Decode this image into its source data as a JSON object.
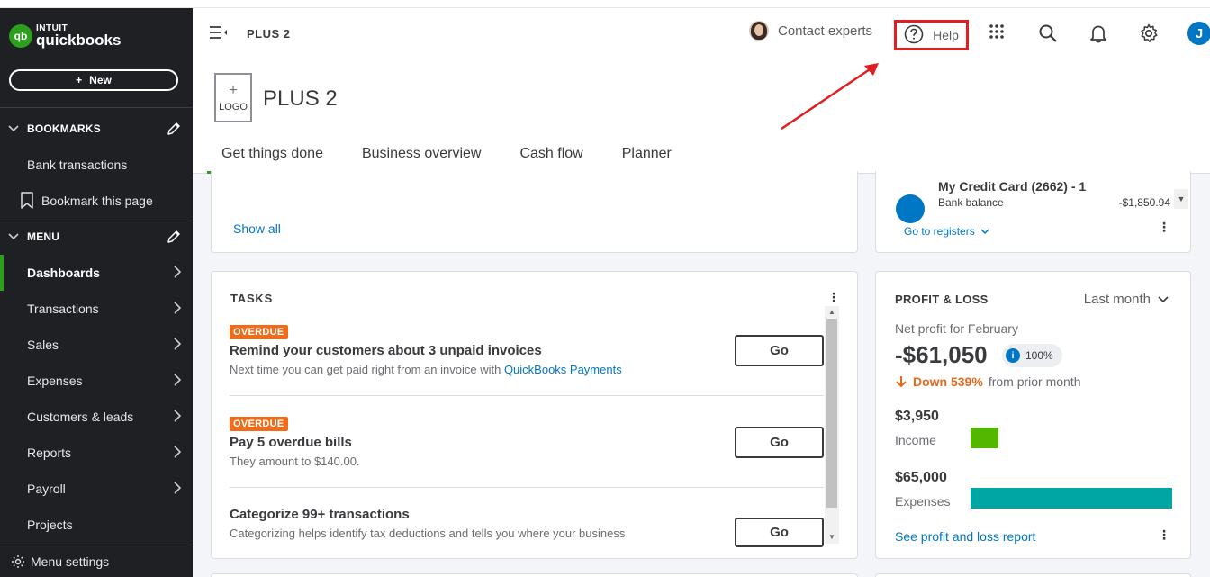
{
  "brand": {
    "intuit": "INTUIT",
    "product": "quickbooks",
    "mark": "qb",
    "accent": "#2ca01c",
    "blue": "#0077c5"
  },
  "sidebar": {
    "new_label": "New",
    "bookmarks_title": "BOOKMARKS",
    "bookmarks": [
      {
        "label": "Bank transactions"
      },
      {
        "label": "Bookmark this page",
        "icon": "bookmark-icon"
      }
    ],
    "menu_title": "MENU",
    "menu": [
      {
        "label": "Dashboards",
        "active": true
      },
      {
        "label": "Transactions"
      },
      {
        "label": "Sales"
      },
      {
        "label": "Expenses"
      },
      {
        "label": "Customers & leads"
      },
      {
        "label": "Reports"
      },
      {
        "label": "Payroll"
      },
      {
        "label": "Projects"
      }
    ],
    "menu_settings": "Menu settings"
  },
  "header": {
    "company_name": "PLUS 2",
    "contact_experts": "Contact experts",
    "help": "Help",
    "user_initial": "J",
    "logo_placeholder": "LOGO",
    "annotation_color": "#e02020"
  },
  "tabs": [
    {
      "label": "Get things done",
      "active": true
    },
    {
      "label": "Business overview"
    },
    {
      "label": "Cash flow"
    },
    {
      "label": "Planner"
    }
  ],
  "top_left_card": {
    "show_all": "Show all"
  },
  "bank_card": {
    "account_name": "My Credit Card (2662) - 1",
    "balance_label": "Bank balance",
    "balance": "-$1,850.94",
    "go_to_registers": "Go to registers"
  },
  "tasks": {
    "title": "TASKS",
    "go_label": "Go",
    "items": [
      {
        "badge": "OVERDUE",
        "title": "Remind your customers about 3 unpaid invoices",
        "desc": "Next time you can get paid right from an invoice with ",
        "link": "QuickBooks Payments"
      },
      {
        "badge": "OVERDUE",
        "title": "Pay 5 overdue bills",
        "desc": "They amount to $140.00.",
        "link": ""
      },
      {
        "badge": "",
        "title": "Categorize 99+ transactions",
        "desc": "Categorizing helps identify tax deductions and tells you where your business",
        "link": ""
      }
    ]
  },
  "profit_loss": {
    "title": "PROFIT & LOSS",
    "period": "Last month",
    "subtitle": "Net profit for February",
    "net_profit": "-$61,050",
    "pct_label": "100%",
    "change": "Down 539%",
    "change_suffix": "from prior month",
    "income_value": "$3,950",
    "income_label": "Income",
    "income_amount": 3950,
    "income_color": "#53b700",
    "expenses_value": "$65,000",
    "expenses_label": "Expenses",
    "expenses_amount": 65000,
    "expenses_color": "#00a6a4",
    "link": "See profit and loss report"
  }
}
